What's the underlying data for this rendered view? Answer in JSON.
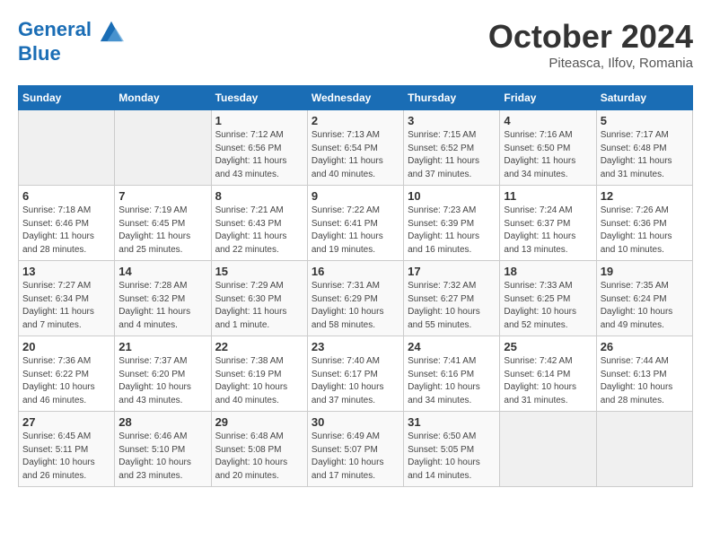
{
  "header": {
    "logo_line1": "General",
    "logo_line2": "Blue",
    "month": "October 2024",
    "location": "Piteasca, Ilfov, Romania"
  },
  "days_of_week": [
    "Sunday",
    "Monday",
    "Tuesday",
    "Wednesday",
    "Thursday",
    "Friday",
    "Saturday"
  ],
  "weeks": [
    [
      {
        "day": "",
        "sunrise": "",
        "sunset": "",
        "daylight": ""
      },
      {
        "day": "",
        "sunrise": "",
        "sunset": "",
        "daylight": ""
      },
      {
        "day": "1",
        "sunrise": "Sunrise: 7:12 AM",
        "sunset": "Sunset: 6:56 PM",
        "daylight": "Daylight: 11 hours and 43 minutes."
      },
      {
        "day": "2",
        "sunrise": "Sunrise: 7:13 AM",
        "sunset": "Sunset: 6:54 PM",
        "daylight": "Daylight: 11 hours and 40 minutes."
      },
      {
        "day": "3",
        "sunrise": "Sunrise: 7:15 AM",
        "sunset": "Sunset: 6:52 PM",
        "daylight": "Daylight: 11 hours and 37 minutes."
      },
      {
        "day": "4",
        "sunrise": "Sunrise: 7:16 AM",
        "sunset": "Sunset: 6:50 PM",
        "daylight": "Daylight: 11 hours and 34 minutes."
      },
      {
        "day": "5",
        "sunrise": "Sunrise: 7:17 AM",
        "sunset": "Sunset: 6:48 PM",
        "daylight": "Daylight: 11 hours and 31 minutes."
      }
    ],
    [
      {
        "day": "6",
        "sunrise": "Sunrise: 7:18 AM",
        "sunset": "Sunset: 6:46 PM",
        "daylight": "Daylight: 11 hours and 28 minutes."
      },
      {
        "day": "7",
        "sunrise": "Sunrise: 7:19 AM",
        "sunset": "Sunset: 6:45 PM",
        "daylight": "Daylight: 11 hours and 25 minutes."
      },
      {
        "day": "8",
        "sunrise": "Sunrise: 7:21 AM",
        "sunset": "Sunset: 6:43 PM",
        "daylight": "Daylight: 11 hours and 22 minutes."
      },
      {
        "day": "9",
        "sunrise": "Sunrise: 7:22 AM",
        "sunset": "Sunset: 6:41 PM",
        "daylight": "Daylight: 11 hours and 19 minutes."
      },
      {
        "day": "10",
        "sunrise": "Sunrise: 7:23 AM",
        "sunset": "Sunset: 6:39 PM",
        "daylight": "Daylight: 11 hours and 16 minutes."
      },
      {
        "day": "11",
        "sunrise": "Sunrise: 7:24 AM",
        "sunset": "Sunset: 6:37 PM",
        "daylight": "Daylight: 11 hours and 13 minutes."
      },
      {
        "day": "12",
        "sunrise": "Sunrise: 7:26 AM",
        "sunset": "Sunset: 6:36 PM",
        "daylight": "Daylight: 11 hours and 10 minutes."
      }
    ],
    [
      {
        "day": "13",
        "sunrise": "Sunrise: 7:27 AM",
        "sunset": "Sunset: 6:34 PM",
        "daylight": "Daylight: 11 hours and 7 minutes."
      },
      {
        "day": "14",
        "sunrise": "Sunrise: 7:28 AM",
        "sunset": "Sunset: 6:32 PM",
        "daylight": "Daylight: 11 hours and 4 minutes."
      },
      {
        "day": "15",
        "sunrise": "Sunrise: 7:29 AM",
        "sunset": "Sunset: 6:30 PM",
        "daylight": "Daylight: 11 hours and 1 minute."
      },
      {
        "day": "16",
        "sunrise": "Sunrise: 7:31 AM",
        "sunset": "Sunset: 6:29 PM",
        "daylight": "Daylight: 10 hours and 58 minutes."
      },
      {
        "day": "17",
        "sunrise": "Sunrise: 7:32 AM",
        "sunset": "Sunset: 6:27 PM",
        "daylight": "Daylight: 10 hours and 55 minutes."
      },
      {
        "day": "18",
        "sunrise": "Sunrise: 7:33 AM",
        "sunset": "Sunset: 6:25 PM",
        "daylight": "Daylight: 10 hours and 52 minutes."
      },
      {
        "day": "19",
        "sunrise": "Sunrise: 7:35 AM",
        "sunset": "Sunset: 6:24 PM",
        "daylight": "Daylight: 10 hours and 49 minutes."
      }
    ],
    [
      {
        "day": "20",
        "sunrise": "Sunrise: 7:36 AM",
        "sunset": "Sunset: 6:22 PM",
        "daylight": "Daylight: 10 hours and 46 minutes."
      },
      {
        "day": "21",
        "sunrise": "Sunrise: 7:37 AM",
        "sunset": "Sunset: 6:20 PM",
        "daylight": "Daylight: 10 hours and 43 minutes."
      },
      {
        "day": "22",
        "sunrise": "Sunrise: 7:38 AM",
        "sunset": "Sunset: 6:19 PM",
        "daylight": "Daylight: 10 hours and 40 minutes."
      },
      {
        "day": "23",
        "sunrise": "Sunrise: 7:40 AM",
        "sunset": "Sunset: 6:17 PM",
        "daylight": "Daylight: 10 hours and 37 minutes."
      },
      {
        "day": "24",
        "sunrise": "Sunrise: 7:41 AM",
        "sunset": "Sunset: 6:16 PM",
        "daylight": "Daylight: 10 hours and 34 minutes."
      },
      {
        "day": "25",
        "sunrise": "Sunrise: 7:42 AM",
        "sunset": "Sunset: 6:14 PM",
        "daylight": "Daylight: 10 hours and 31 minutes."
      },
      {
        "day": "26",
        "sunrise": "Sunrise: 7:44 AM",
        "sunset": "Sunset: 6:13 PM",
        "daylight": "Daylight: 10 hours and 28 minutes."
      }
    ],
    [
      {
        "day": "27",
        "sunrise": "Sunrise: 6:45 AM",
        "sunset": "Sunset: 5:11 PM",
        "daylight": "Daylight: 10 hours and 26 minutes."
      },
      {
        "day": "28",
        "sunrise": "Sunrise: 6:46 AM",
        "sunset": "Sunset: 5:10 PM",
        "daylight": "Daylight: 10 hours and 23 minutes."
      },
      {
        "day": "29",
        "sunrise": "Sunrise: 6:48 AM",
        "sunset": "Sunset: 5:08 PM",
        "daylight": "Daylight: 10 hours and 20 minutes."
      },
      {
        "day": "30",
        "sunrise": "Sunrise: 6:49 AM",
        "sunset": "Sunset: 5:07 PM",
        "daylight": "Daylight: 10 hours and 17 minutes."
      },
      {
        "day": "31",
        "sunrise": "Sunrise: 6:50 AM",
        "sunset": "Sunset: 5:05 PM",
        "daylight": "Daylight: 10 hours and 14 minutes."
      },
      {
        "day": "",
        "sunrise": "",
        "sunset": "",
        "daylight": ""
      },
      {
        "day": "",
        "sunrise": "",
        "sunset": "",
        "daylight": ""
      }
    ]
  ]
}
